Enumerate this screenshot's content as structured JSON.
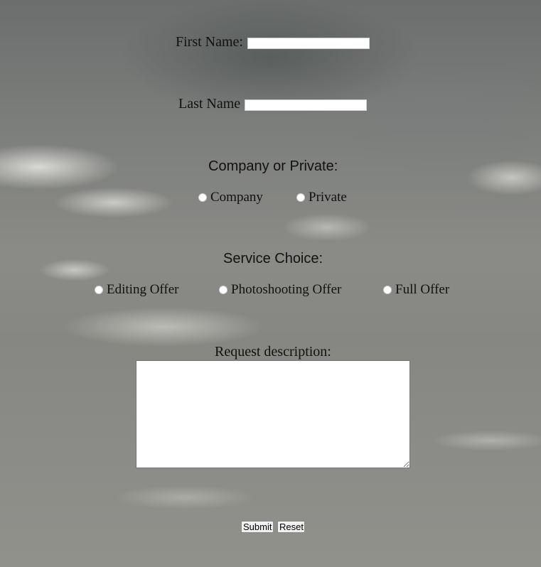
{
  "form": {
    "first_name": {
      "label": "First Name:",
      "value": ""
    },
    "last_name": {
      "label": "Last Name",
      "value": ""
    },
    "company_or_private": {
      "heading": "Company or Private:",
      "options": [
        "Company",
        "Private"
      ],
      "selected": null
    },
    "service_choice": {
      "heading": "Service Choice:",
      "options": [
        "Editing Offer",
        "Photoshooting Offer",
        "Full Offer"
      ],
      "selected": null
    },
    "request_description": {
      "label": "Request description:",
      "value": ""
    },
    "buttons": {
      "submit": "Submit",
      "reset": "Reset"
    }
  }
}
